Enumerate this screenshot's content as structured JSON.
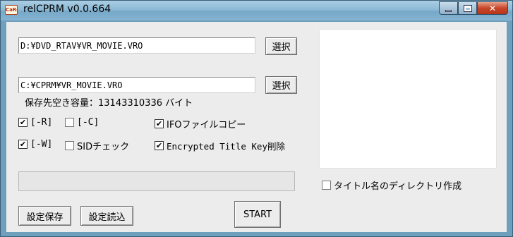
{
  "window": {
    "title": "relCPRM v0.0.664",
    "app_icon_text": "CaRel"
  },
  "source": {
    "path": "D:¥DVD_RTAV¥VR_MOVIE.VRO",
    "select_label": "選択"
  },
  "destination": {
    "path": "C:¥CPRM¥VR_MOVIE.VRO",
    "select_label": "選択",
    "free_space_label": "保存先空き容量：13143310336 バイト"
  },
  "options": {
    "r": {
      "label": "[-R]",
      "checked": true
    },
    "c": {
      "label": "[-C]",
      "checked": false
    },
    "ifo_copy": {
      "label": "IFOファイルコピー",
      "checked": true
    },
    "w": {
      "label": "[-W]",
      "checked": true
    },
    "sid_check": {
      "label": "SIDチェック",
      "checked": false
    },
    "encrypted_title_key_delete": {
      "label": "Encrypted Title Key削除",
      "checked": true
    },
    "title_dir": {
      "label": "タイトル名のディレクトリ作成",
      "checked": false
    }
  },
  "progress": {
    "value": 0
  },
  "buttons": {
    "save_settings": "設定保存",
    "load_settings": "設定読込",
    "start": "START"
  },
  "check_glyph": "✔",
  "colors": {
    "titlebar": "#8dbad6",
    "close_button": "#c7452a",
    "progress_fill": "#4fc34f"
  }
}
